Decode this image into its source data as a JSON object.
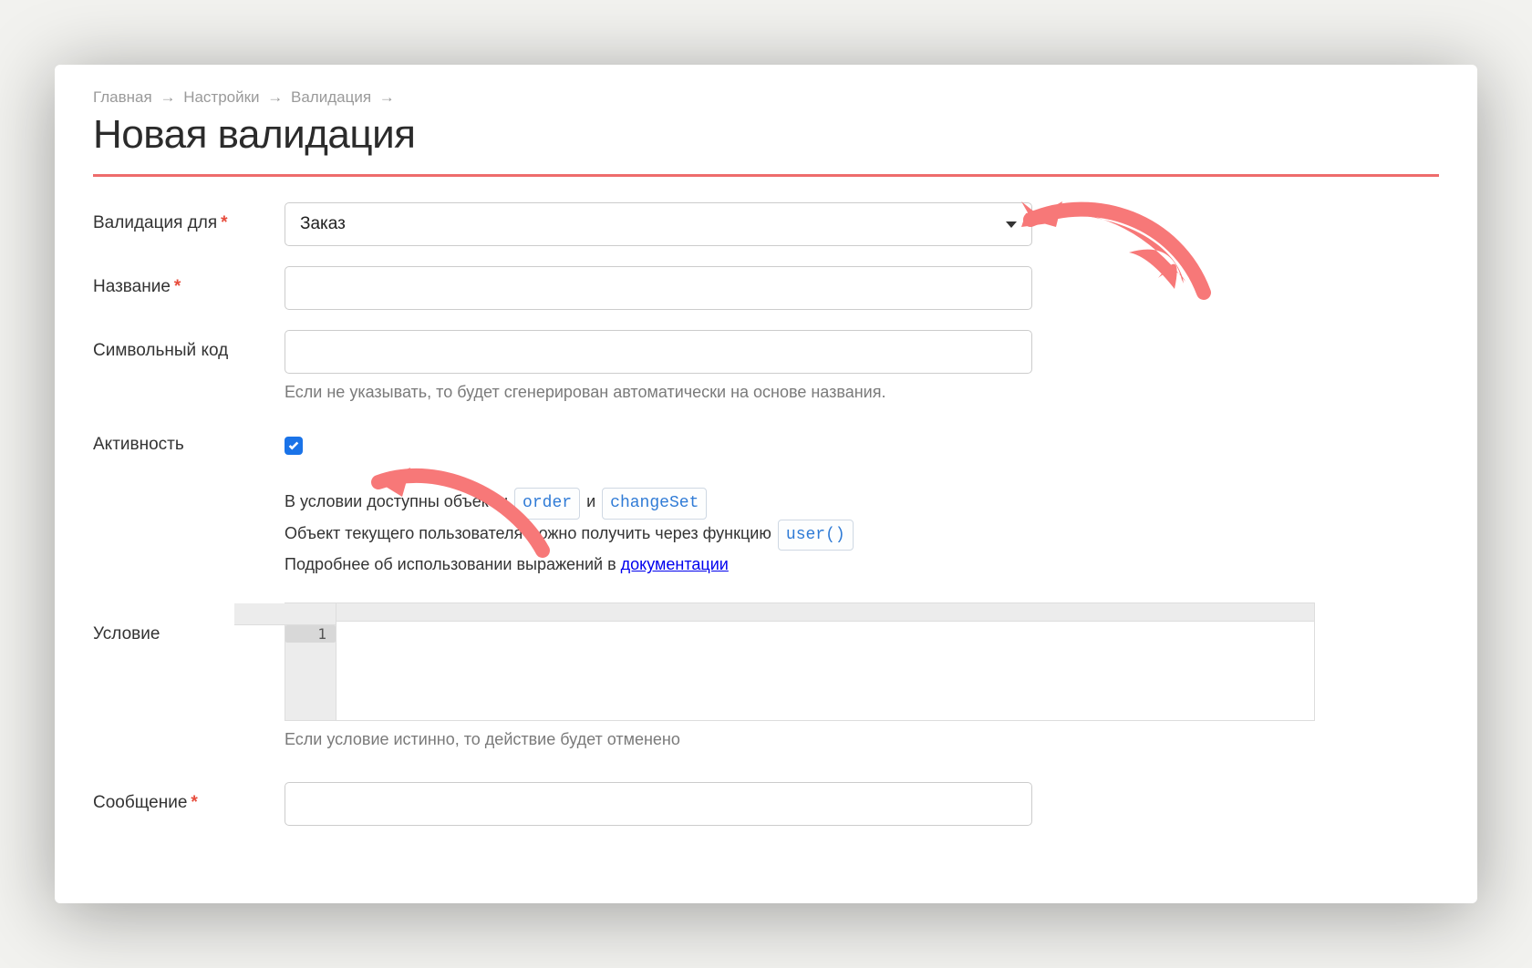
{
  "breadcrumb": {
    "items": [
      "Главная",
      "Настройки",
      "Валидация"
    ],
    "separator": "→"
  },
  "page": {
    "title": "Новая валидация"
  },
  "form": {
    "validation_for": {
      "label": "Валидация для",
      "selected": "Заказ"
    },
    "name": {
      "label": "Название",
      "value": ""
    },
    "code": {
      "label": "Символьный код",
      "value": "",
      "hint": "Если не указывать, то будет сгенерирован автоматически на основе названия."
    },
    "active": {
      "label": "Активность",
      "checked": true
    },
    "info": {
      "line1_prefix": "В условии доступны объекты",
      "order_tag": "order",
      "and_word": "и",
      "changeset_tag": "changeSet",
      "line2_prefix": "Объект текущего пользователя можно получить через функцию",
      "user_fn_tag": "user()",
      "line3_prefix": "Подробнее об использовании выражений в",
      "doc_link": "документации"
    },
    "condition": {
      "label": "Условие",
      "line_number": "1",
      "value": "",
      "hint": "Если условие истинно, то действие будет отменено"
    },
    "message": {
      "label": "Сообщение",
      "value": ""
    }
  }
}
